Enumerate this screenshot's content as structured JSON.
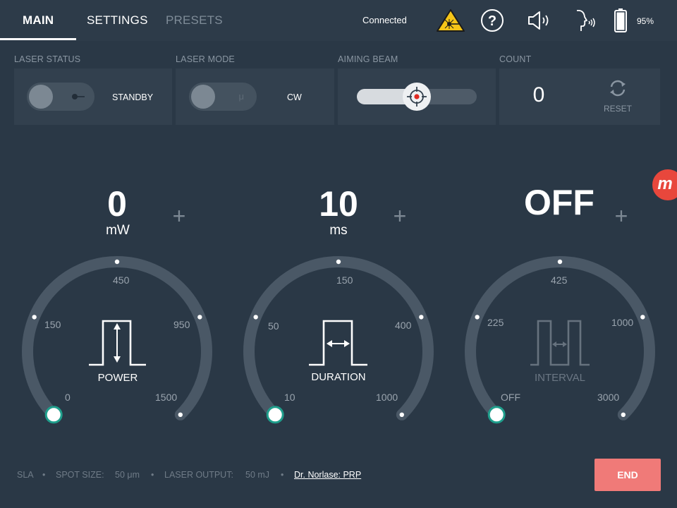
{
  "tabs": [
    {
      "label": "MAIN",
      "active": true
    },
    {
      "label": "SETTINGS",
      "active": false
    },
    {
      "label": "PRESETS",
      "active": false
    }
  ],
  "topbar": {
    "connection": "Connected",
    "battery": "95%",
    "icons": [
      "laser-warning-icon",
      "help-icon",
      "speaker-icon",
      "voice-icon",
      "battery-icon"
    ]
  },
  "status": {
    "laser_status": {
      "label": "LASER STATUS",
      "value": "STANDBY"
    },
    "laser_mode": {
      "label": "LASER MODE",
      "value": "CW",
      "toggle_glyph": "μ"
    },
    "aiming_beam": {
      "label": "AIMING BEAM",
      "level": 0.5
    },
    "count": {
      "label": "COUNT",
      "value": "0",
      "reset_label": "RESET"
    }
  },
  "dials": [
    {
      "name": "POWER",
      "value": "0",
      "unit": "mW",
      "ticks": [
        "0",
        "150",
        "450",
        "950",
        "1500"
      ]
    },
    {
      "name": "DURATION",
      "value": "10",
      "unit": "ms",
      "ticks": [
        "10",
        "50",
        "150",
        "400",
        "1000"
      ]
    },
    {
      "name": "INTERVAL",
      "value": "OFF",
      "unit": "",
      "ticks": [
        "OFF",
        "225",
        "425",
        "1000",
        "3000"
      ]
    }
  ],
  "footer": {
    "procedure": "SLA",
    "spot_size_label": "SPOT SIZE:",
    "spot_size_value": "50 μm",
    "laser_output_label": "LASER OUTPUT:",
    "laser_output_value": "50 mJ",
    "preset_link": "Dr. Norlase: PRP",
    "separator": "•",
    "end_label": "END"
  },
  "badge": {
    "text": "m"
  },
  "colors": {
    "background": "#2a3846",
    "panel": "#32404e",
    "dial_track": "#4a5866",
    "knob_ring": "#1f9e8c",
    "end_button": "#f07a78",
    "warning": "#f5c518"
  }
}
